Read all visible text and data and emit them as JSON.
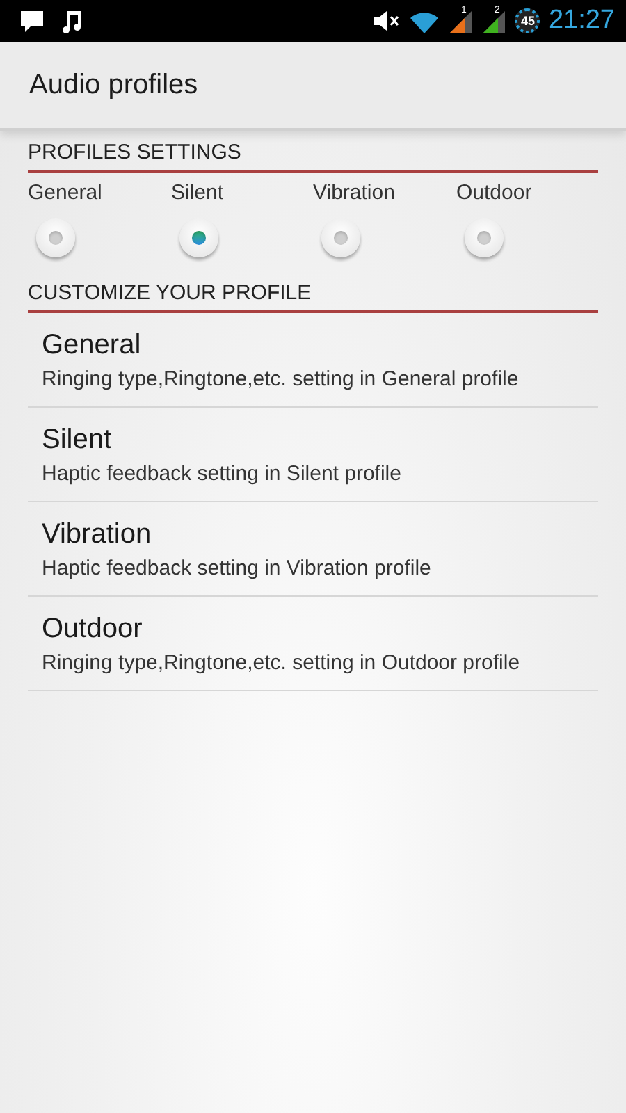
{
  "status_bar": {
    "sim1": "1",
    "sim2": "2",
    "battery": "45",
    "time": "21:27"
  },
  "action_bar": {
    "title": "Audio profiles"
  },
  "profiles_settings": {
    "heading": "PROFILES SETTINGS",
    "options": [
      {
        "label": "General",
        "selected": false
      },
      {
        "label": "Silent",
        "selected": true
      },
      {
        "label": "Vibration",
        "selected": false
      },
      {
        "label": "Outdoor",
        "selected": false
      }
    ]
  },
  "customize": {
    "heading": "CUSTOMIZE YOUR PROFILE",
    "items": [
      {
        "title": "General",
        "summary": "Ringing type,Ringtone,etc. setting in General profile"
      },
      {
        "title": "Silent",
        "summary": "Haptic feedback setting in Silent profile"
      },
      {
        "title": "Vibration",
        "summary": "Haptic feedback setting in Vibration profile"
      },
      {
        "title": "Outdoor",
        "summary": "Ringing type,Ringtone,etc. setting in Outdoor profile"
      }
    ]
  }
}
